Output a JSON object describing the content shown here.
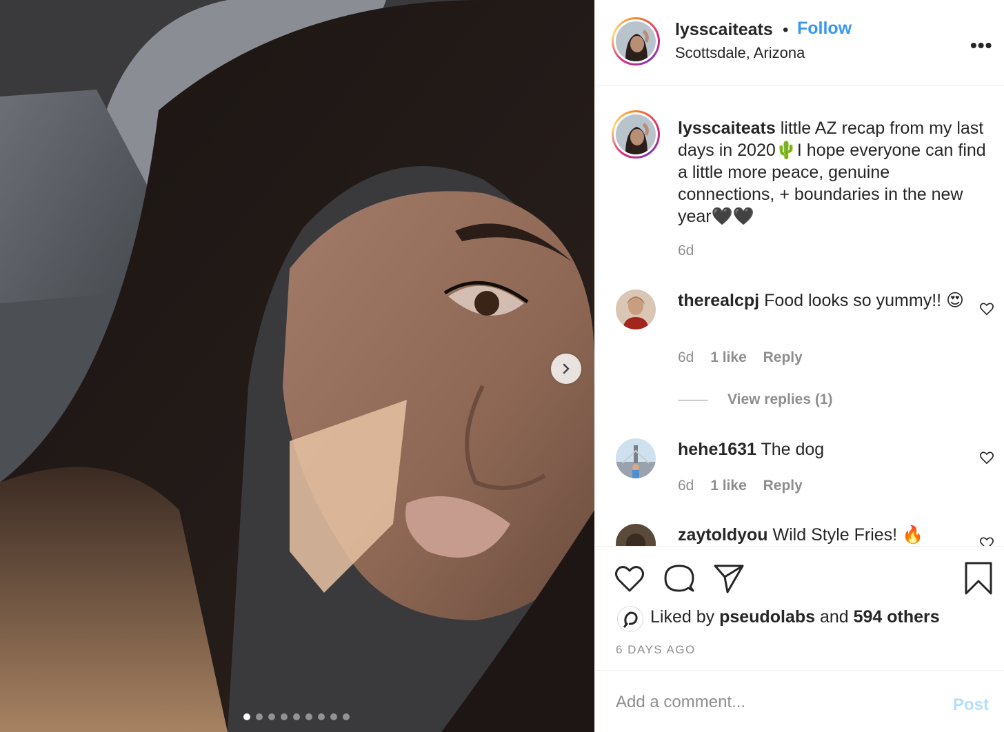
{
  "post": {
    "dots_count": 9,
    "active_dot": 0
  },
  "header": {
    "username": "lysscaiteats",
    "separator": "•",
    "follow_label": "Follow",
    "location": "Scottsdale, Arizona",
    "more_label": "•••"
  },
  "caption": {
    "username": "lysscaiteats",
    "text": "little AZ recap from my last days in 2020🌵I hope everyone can find a little more peace, genuine connections, + boundaries in the new year🖤🖤",
    "age": "6d"
  },
  "comments": [
    {
      "username": "therealcpj",
      "text": "Food looks so yummy!! 😍",
      "age": "6d",
      "likes": "1 like",
      "reply_label": "Reply",
      "view_replies": "View replies (1)"
    },
    {
      "username": "hehe1631",
      "text": "The dog",
      "age": "6d",
      "likes": "1 like",
      "reply_label": "Reply"
    },
    {
      "username": "zaytoldyou",
      "text": "Wild Style Fries! 🔥"
    }
  ],
  "likes": {
    "prefix": "Liked by",
    "liker": "pseudolabs",
    "and": "and",
    "others": "594 others"
  },
  "timestamp": "6 DAYS AGO",
  "composer": {
    "placeholder": "Add a comment...",
    "post_label": "Post"
  },
  "colors": {
    "accent": "#3897f0",
    "post_disabled": "#b2dffc",
    "muted": "#8e8e8e",
    "text": "#262626"
  }
}
